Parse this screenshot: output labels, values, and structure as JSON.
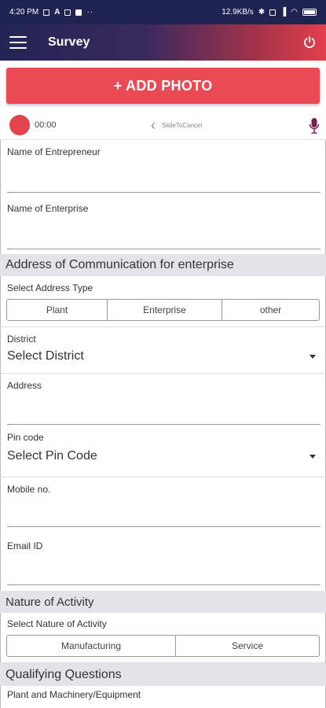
{
  "status_bar": {
    "time": "4:20 PM",
    "left_icons": [
      "photo-icon",
      "a-icon",
      "storage-icon",
      "youtube-icon"
    ],
    "more": "··",
    "speed": "12.9KB/s",
    "right_icons": [
      "bluetooth-icon",
      "sim-icon",
      "signal-icon",
      "wifi-icon",
      "battery-icon"
    ]
  },
  "app_bar": {
    "title": "Survey"
  },
  "add_photo": {
    "label": "+ ADD PHOTO"
  },
  "recorder": {
    "time": "00:00",
    "slide_label": "SlideToCancel"
  },
  "form": {
    "entrepreneur_label": "Name of Entrepreneur",
    "enterprise_label": "Name of Enterprise",
    "address_section": "Address of Communication for enterprise",
    "address_type_label": "Select Address Type",
    "address_types": [
      "Plant",
      "Enterprise",
      "other"
    ],
    "district_label": "District",
    "district_value": "Select District",
    "address_label": "Address",
    "pincode_label": "Pin code",
    "pincode_value": "Select Pin Code",
    "mobile_label": "Mobile no.",
    "email_label": "Email ID",
    "nature_section": "Nature of Activity",
    "nature_label": "Select Nature of Activity",
    "nature_options": [
      "Manufacturing",
      "Service"
    ],
    "qualifying_section": "Qualifying Questions",
    "plant_label": "Plant and Machinery/Equipment"
  },
  "colors": {
    "accent": "#ea4a53",
    "status_bar": "#1e2352",
    "section_bg": "#e3e4ea"
  }
}
